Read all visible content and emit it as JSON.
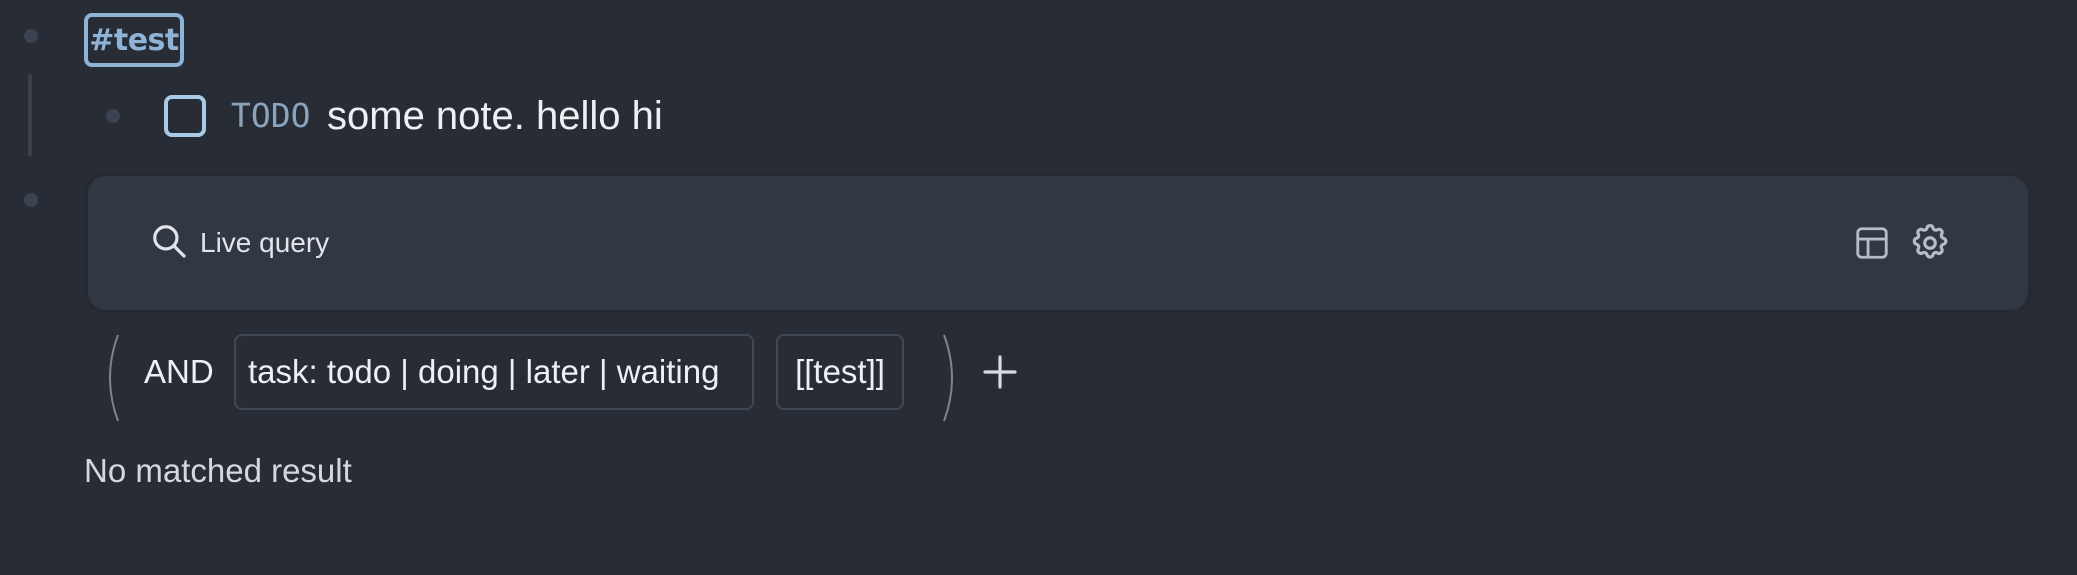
{
  "block": {
    "tag": "#test",
    "child": {
      "marker": "TODO",
      "text": "some note. hello hi"
    }
  },
  "query": {
    "label": "Live query",
    "search_icon": "search-icon",
    "view_icon": "table-icon",
    "settings_icon": "gear-icon",
    "operator": "AND",
    "filters": [
      {
        "text": "task: todo | doing | later | waiting"
      },
      {
        "text": "[[test]]"
      }
    ],
    "add_icon": "plus-icon",
    "empty_message": "No matched result"
  },
  "colors": {
    "background": "#282c34",
    "query_panel": "#323843",
    "tag_accent": "#8db3d6",
    "checkbox_border": "#a9c9e8",
    "todo_marker": "#8aa4bd"
  }
}
